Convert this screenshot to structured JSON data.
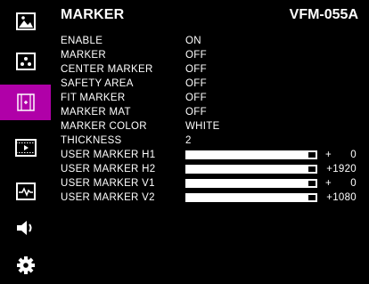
{
  "header": {
    "title": "MARKER",
    "model": "VFM-055A"
  },
  "sidebar": {
    "items": [
      {
        "icon": "image-icon",
        "active": false
      },
      {
        "icon": "dots-pattern-icon",
        "active": false
      },
      {
        "icon": "marker-frame-icon",
        "active": true
      },
      {
        "icon": "film-icon",
        "active": false
      },
      {
        "icon": "waveform-icon",
        "active": false
      },
      {
        "icon": "speaker-icon",
        "active": false
      },
      {
        "icon": "gear-icon",
        "active": false
      }
    ],
    "active_color": "#b000a8"
  },
  "settings": [
    {
      "label": "ENABLE",
      "value": "ON"
    },
    {
      "label": "MARKER",
      "value": "OFF"
    },
    {
      "label": "CENTER MARKER",
      "value": "OFF"
    },
    {
      "label": "SAFETY AREA",
      "value": "OFF"
    },
    {
      "label": "FIT MARKER",
      "value": "OFF"
    },
    {
      "label": "MARKER MAT",
      "value": "OFF"
    },
    {
      "label": "MARKER COLOR",
      "value": "WHITE"
    },
    {
      "label": "THICKNESS",
      "value": "2"
    }
  ],
  "sliders": [
    {
      "label": "USER MARKER H1",
      "sign": "+",
      "number": "0",
      "level": 1.0
    },
    {
      "label": "USER MARKER H2",
      "sign": "",
      "number": "+1920",
      "level": 1.0
    },
    {
      "label": "USER MARKER V1",
      "sign": "+",
      "number": "0",
      "level": 1.0
    },
    {
      "label": "USER MARKER V2",
      "sign": "",
      "number": "+1080",
      "level": 1.0
    }
  ]
}
